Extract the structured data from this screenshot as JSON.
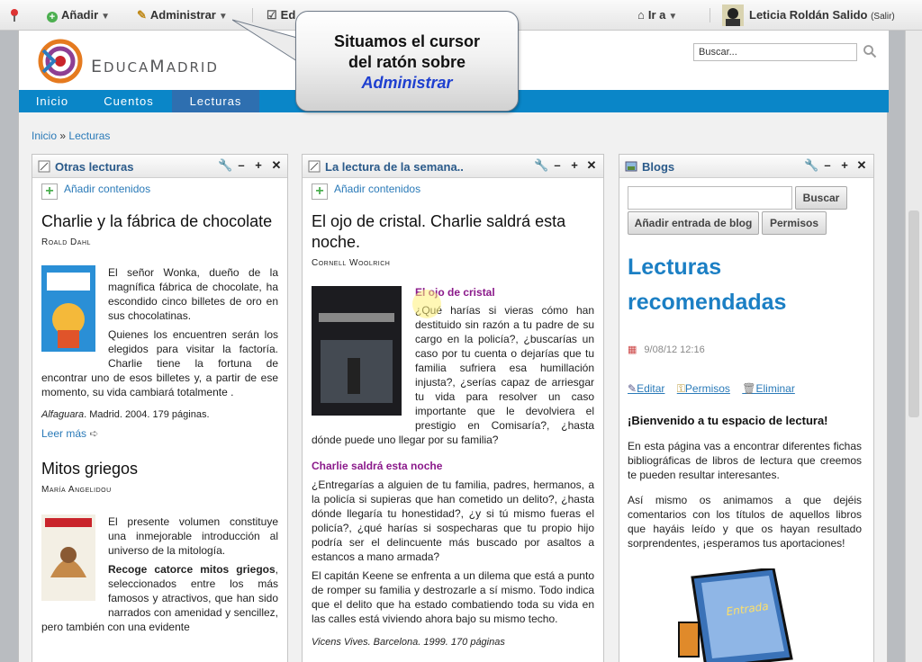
{
  "dockbar": {
    "add_label": "Añadir",
    "manage_label": "Administrar",
    "edit_label": "Ed",
    "goto_label": "Ir a",
    "user_name": "Leticia Roldán Salido",
    "logout_label": "(Salir)"
  },
  "header": {
    "logo_text_e": "E",
    "logo_text_duca": "DUCA",
    "logo_text_m": "M",
    "logo_text_adrid": "ADRID",
    "search_value": "Buscar..."
  },
  "nav": {
    "items": [
      "Inicio",
      "Cuentos",
      "Lecturas"
    ],
    "active": "Lecturas"
  },
  "breadcrumb": {
    "home": "Inicio",
    "separator": "»",
    "current": "Lecturas"
  },
  "callout": {
    "line1": "Situamos el cursor",
    "line2": "del ratón sobre",
    "line3": "Administrar"
  },
  "portlet_otras": {
    "title": "Otras lecturas",
    "add_content": "Añadir contenidos",
    "book1": {
      "title": "Charlie y la fábrica de chocolate",
      "author": "Roald Dahl",
      "para1": "El señor Wonka, dueño de la magnífica fábrica de chocolate, ha escondido cinco billetes de oro en sus chocolatinas.",
      "para2": "Quienes los encuentren serán los elegidos para visitar la factoría. Charlie tiene la fortuna de encontrar uno de esos billetes y, a partir de ese momento, su vida cambiará totalmente .",
      "publisher": "Alfaguara",
      "pub_rest": ". Madrid. 2004. 179 páginas.",
      "more": "Leer más"
    },
    "book2": {
      "title": "Mitos griegos",
      "author": "María Angelidou",
      "para1": "El presente volumen constituye una inmejorable introducción al universo de la mitología.",
      "para2_bold": "Recoge catorce mitos griegos",
      "para2_rest": ", seleccionados entre los más famosos y atractivos, que han sido narrados con amenidad y sencillez, pero también con una evidente"
    }
  },
  "portlet_semana": {
    "title": "La lectura de la semana..",
    "add_content": "Añadir contenidos",
    "book_title": "El ojo de cristal. Charlie saldrá esta noche.",
    "author": "Cornell Woolrich",
    "sub1": "El ojo de cristal",
    "para1": "¿Qué harías si vieras cómo han destituido sin razón a tu padre de su cargo en la policía?, ¿buscarías un caso por tu cuenta o dejarías que tu familia sufriera esa humillación injusta?, ¿serías capaz de arriesgar tu vida para resolver un caso importante que le devolviera el prestigio en Comisaría?, ¿hasta dónde puede uno llegar por su familia?",
    "sub2": "Charlie saldrá esta noche",
    "para2": "¿Entregarías a alguien de tu familia, padres, hermanos, a la policía si supieras que han cometido un delito?, ¿hasta dónde llegaría tu honestidad?, ¿y si tú mismo fueras el policía?, ¿qué harías si sospecharas que tu propio hijo podría ser el delincuente más buscado por asaltos a estancos a mano armada?",
    "para3": "El capitán Keene se enfrenta a un dilema que está a punto de romper su familia y destrozarle a sí mismo. Todo indica que el delito que ha estado combatiendo toda su vida en las calles está viviendo ahora bajo su mismo techo.",
    "pub": "Vicens Vives. Barcelona. 1999. 170 páginas"
  },
  "portlet_blogs": {
    "title": "Blogs",
    "search_button": "Buscar",
    "add_entry": "Añadir entrada de blog",
    "permissions_button": "Permisos",
    "blog_title": "Lecturas recomendadas",
    "date": "9/08/12 12:16",
    "edit": "Editar",
    "permissions": "Permisos",
    "delete": "Eliminar",
    "welcome": "¡Bienvenido a tu espacio de lectura!",
    "para1": "En esta página vas a encontrar diferentes fichas bibliográficas de libros de lectura que creemos te pueden resultar interesantes.",
    "para2": "Así mismo os animamos a que dejéis comentarios con los títulos de aquellos libros que hayáis leído y que os hayan resultado sorprendentes, ¡esperamos tus aportaciones!",
    "book_label": "Entrada"
  },
  "colors": {
    "nav_blue": "#0a86c8",
    "link_blue": "#2a7ab8",
    "title_blue": "#1b7fc4",
    "purple": "#8b1a8b"
  }
}
